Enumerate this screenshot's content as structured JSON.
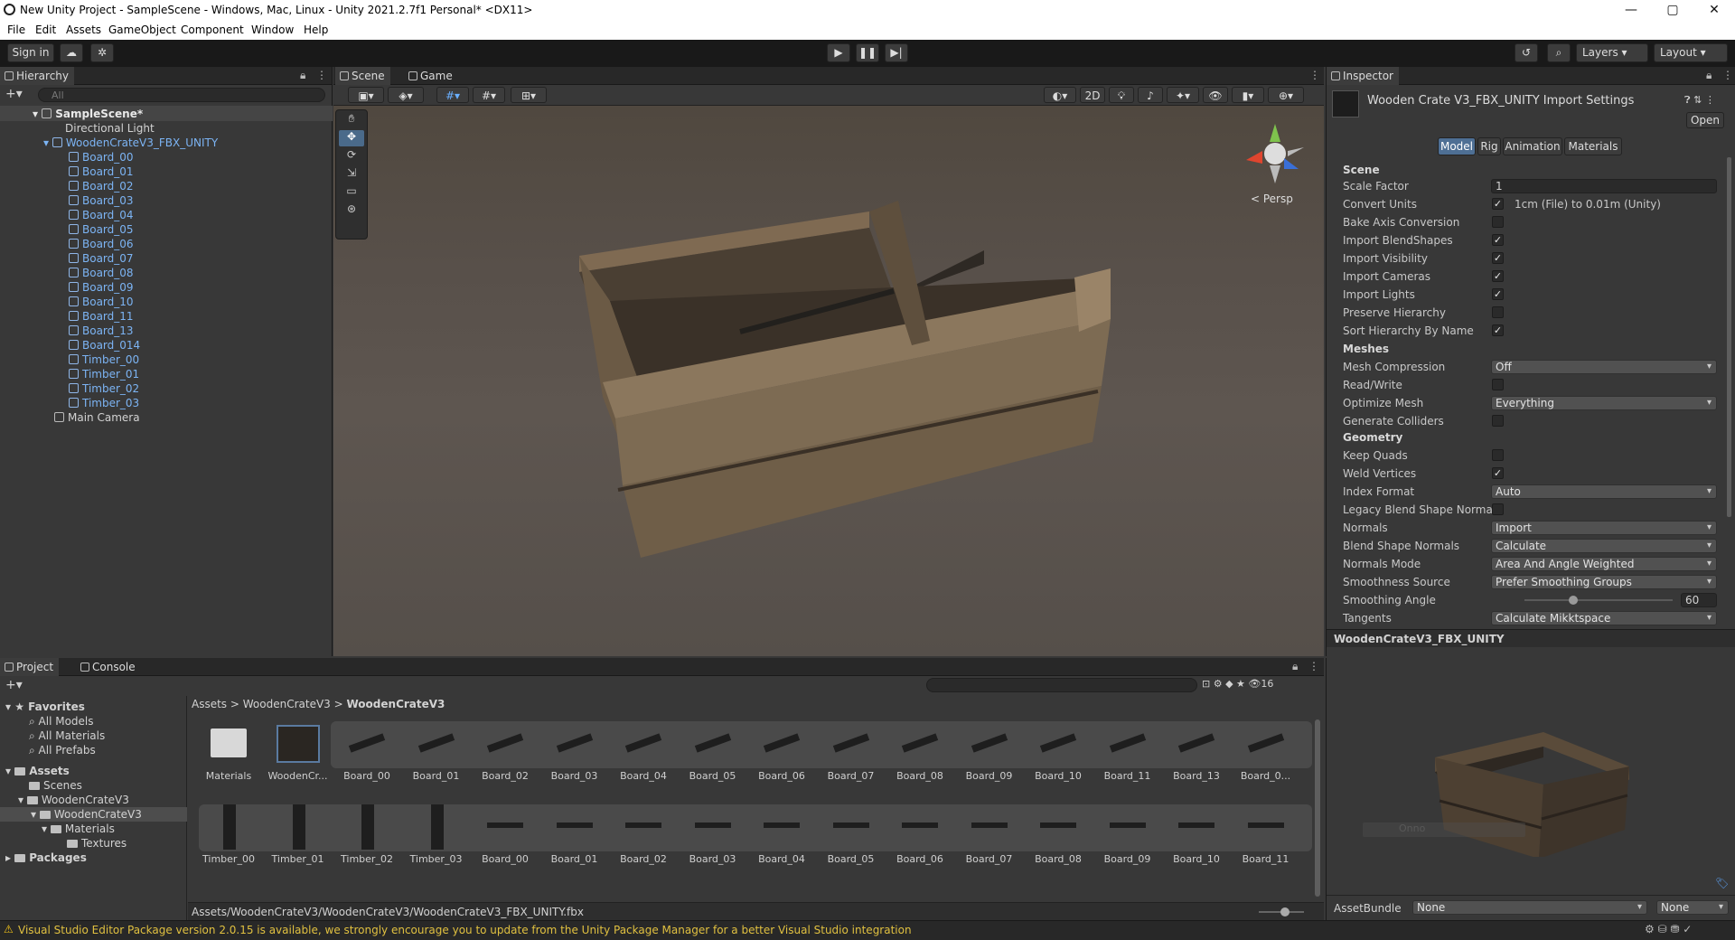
{
  "window": {
    "title": "New Unity Project - SampleScene - Windows, Mac, Linux - Unity 2021.2.7f1 Personal* <DX11>",
    "minimize": "—",
    "maximize": "▢",
    "close": "✕"
  },
  "menu": [
    "File",
    "Edit",
    "Assets",
    "GameObject",
    "Component",
    "Window",
    "Help"
  ],
  "toolbar": {
    "sign_in": "Sign in",
    "layers": "Layers",
    "layout": "Layout"
  },
  "hierarchy": {
    "tab": "Hierarchy",
    "search_placeholder": "All",
    "scene": "SampleScene*",
    "items": [
      "Directional Light",
      "WoodenCrateV3_FBX_UNITY",
      "Board_00",
      "Board_01",
      "Board_02",
      "Board_03",
      "Board_04",
      "Board_05",
      "Board_06",
      "Board_07",
      "Board_08",
      "Board_09",
      "Board_10",
      "Board_11",
      "Board_13",
      "Board_014",
      "Timber_00",
      "Timber_01",
      "Timber_02",
      "Timber_03",
      "Main Camera"
    ]
  },
  "scene": {
    "tabs": [
      "Scene",
      "Game"
    ],
    "mode_2d": "2D",
    "persp": "< Persp"
  },
  "inspector": {
    "tab": "Inspector",
    "title": "Wooden Crate V3_FBX_UNITY Import Settings",
    "open": "Open",
    "tabs": [
      "Model",
      "Rig",
      "Animation",
      "Materials"
    ],
    "sec_scene": "Scene",
    "sec_meshes": "Meshes",
    "sec_geometry": "Geometry",
    "scale_factor_label": "Scale Factor",
    "scale_factor": "1",
    "convert_units_label": "Convert Units",
    "convert_units_note": "1cm (File) to 0.01m (Unity)",
    "bake_axis": "Bake Axis Conversion",
    "import_blend": "Import BlendShapes",
    "import_vis": "Import Visibility",
    "import_cams": "Import Cameras",
    "import_lights": "Import Lights",
    "preserve": "Preserve Hierarchy",
    "sort": "Sort Hierarchy By Name",
    "mesh_comp_label": "Mesh Compression",
    "mesh_comp": "Off",
    "rw": "Read/Write",
    "opt_label": "Optimize Mesh",
    "opt": "Everything",
    "gen_col": "Generate Colliders",
    "keep_quads": "Keep Quads",
    "weld": "Weld Vertices",
    "idx_label": "Index Format",
    "idx": "Auto",
    "legacy": "Legacy Blend Shape Normals",
    "normals_label": "Normals",
    "normals": "Import",
    "bsn_label": "Blend Shape Normals",
    "bsn": "Calculate",
    "nm_label": "Normals Mode",
    "nm": "Area And Angle Weighted",
    "ss_label": "Smoothness Source",
    "ss": "Prefer Smoothing Groups",
    "sa_label": "Smoothing Angle",
    "sa": "60",
    "tan_label": "Tangents",
    "tan": "Calculate Mikktspace",
    "smoothing_angle_fraction": 0.33
  },
  "preview": {
    "name": "WoodenCrateV3_FBX_UNITY",
    "ghost": "Onno",
    "assetbundle_label": "AssetBundle",
    "ab1": "None",
    "ab2": "None"
  },
  "project": {
    "tabs": [
      "Project",
      "Console"
    ],
    "count": "16",
    "favorites": "Favorites",
    "fav_items": [
      "All Models",
      "All Materials",
      "All Prefabs"
    ],
    "assets": "Assets",
    "tree": [
      "Scenes",
      "WoodenCrateV3",
      "WoodenCrateV3",
      "Materials",
      "Textures"
    ],
    "packages": "Packages",
    "breadcrumb": [
      "Assets",
      "WoodenCrateV3",
      "WoodenCrateV3"
    ],
    "row1": [
      "Materials",
      "WoodenCr...",
      "Board_00",
      "Board_01",
      "Board_02",
      "Board_03",
      "Board_04",
      "Board_05",
      "Board_06",
      "Board_07",
      "Board_08",
      "Board_09",
      "Board_10",
      "Board_11",
      "Board_13",
      "Board_0..."
    ],
    "row2": [
      "Timber_00",
      "Timber_01",
      "Timber_02",
      "Timber_03",
      "Board_00",
      "Board_01",
      "Board_02",
      "Board_03",
      "Board_04",
      "Board_05",
      "Board_06",
      "Board_07",
      "Board_08",
      "Board_09",
      "Board_10",
      "Board_11"
    ],
    "path": "Assets/WoodenCrateV3/WoodenCrateV3/WoodenCrateV3_FBX_UNITY.fbx"
  },
  "status": {
    "message": "Visual Studio Editor Package version 2.0.15 is available, we strongly encourage you to update from the Unity Package Manager for a better Visual Studio integration"
  }
}
